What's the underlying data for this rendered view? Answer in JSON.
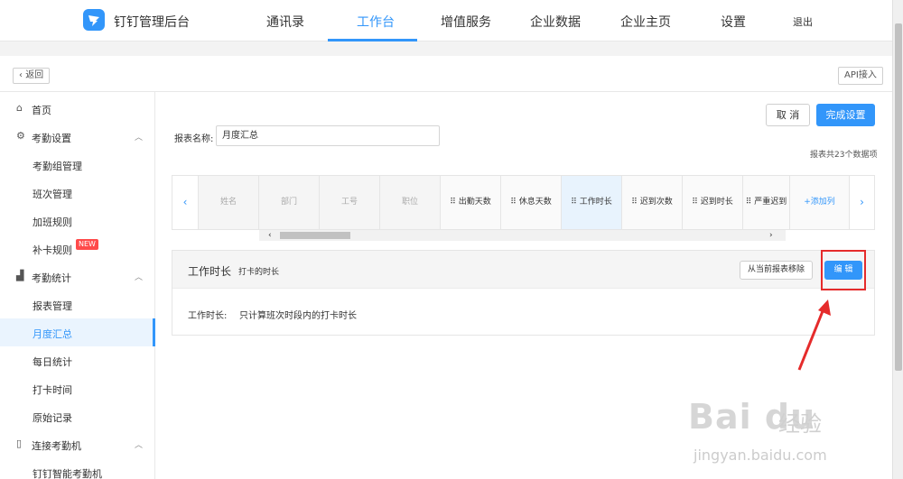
{
  "app": {
    "title": "钉钉管理后台"
  },
  "nav": {
    "items": [
      "通讯录",
      "工作台",
      "增值服务",
      "企业数据",
      "企业主页",
      "设置"
    ],
    "active": "工作台",
    "logout": "退出"
  },
  "backbar": {
    "back_label": "返回",
    "api_label": "API接入"
  },
  "sidebar": {
    "items": [
      {
        "label": "首页",
        "icon": "home-icon"
      },
      {
        "label": "考勤设置",
        "icon": "settings-icon"
      },
      {
        "label": "考勤组管理"
      },
      {
        "label": "班次管理"
      },
      {
        "label": "加班规则"
      },
      {
        "label": "补卡规则",
        "badge": "NEW"
      },
      {
        "label": "考勤统计",
        "icon": "chart-icon"
      },
      {
        "label": "报表管理"
      },
      {
        "label": "月度汇总",
        "active": true
      },
      {
        "label": "每日统计"
      },
      {
        "label": "打卡时间"
      },
      {
        "label": "原始记录"
      },
      {
        "label": "连接考勤机",
        "icon": "device-icon"
      },
      {
        "label": "钉钉智能考勤机"
      }
    ]
  },
  "main": {
    "cancel_label": "取 消",
    "done_label": "完成设置",
    "report_name_label": "报表名称:",
    "report_name_value": "月度汇总",
    "count_text": "报表共23个数据项",
    "columns": [
      "姓名",
      "部门",
      "工号",
      "职位",
      "⠿ 出勤天数",
      "⠿ 休息天数",
      "⠿ 工作时长",
      "⠿ 迟到次数",
      "⠿ 迟到时长",
      "⠿ 严重迟到",
      "+添加列"
    ],
    "selected_column": "⠿ 工作时长"
  },
  "detail": {
    "title": "工作时长",
    "subtitle": "打卡的时长",
    "remove_label": "从当前报表移除",
    "edit_label": "编 辑",
    "desc_label": "工作时长:",
    "desc_text": "只计算班次时段内的打卡时长"
  },
  "watermark": {
    "logo": "Bai du",
    "text": "经验",
    "url": "jingyan.baidu.com"
  },
  "colors": {
    "accent": "#3296fa",
    "highlight": "#e52b2b"
  }
}
